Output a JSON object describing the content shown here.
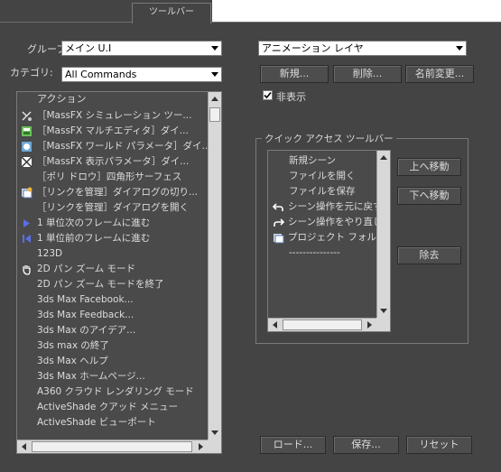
{
  "tabs": {
    "active_label": "ツールバー"
  },
  "left": {
    "group_label": "グループ",
    "group_value": "メイン U.I",
    "category_label": "カテゴリ:",
    "category_value": "All Commands",
    "list_header": "アクション",
    "items": [
      {
        "icon": "massfx-sim-icon",
        "label": "［MassFX シミュレーション ツー..."
      },
      {
        "icon": "massfx-multi-editor-icon",
        "label": "［MassFX マルチエディタ］ダイ..."
      },
      {
        "icon": "massfx-world-params-icon",
        "label": "［MassFX ワールド パラメータ］ダイ..."
      },
      {
        "icon": "massfx-display-params-icon",
        "label": "［MassFX 表示パラメータ］ダイ..."
      },
      {
        "icon": "",
        "label": "［ポリ ドロウ］四角形サーフェス"
      },
      {
        "icon": "manage-links-icon",
        "label": "［リンクを管理］ダイアログの切り..."
      },
      {
        "icon": "",
        "label": "［リンクを管理］ダイアログを開く"
      },
      {
        "icon": "next-frame-icon",
        "label": "1 単位次のフレームに進む"
      },
      {
        "icon": "prev-frame-icon",
        "label": "1 単位前のフレームに進む"
      },
      {
        "icon": "",
        "label": "123D"
      },
      {
        "icon": "pan-zoom-icon",
        "label": "2D パン ズーム モード"
      },
      {
        "icon": "",
        "label": "2D パン ズーム モードを終了"
      },
      {
        "icon": "",
        "label": "3ds Max Facebook..."
      },
      {
        "icon": "",
        "label": "3ds Max Feedback..."
      },
      {
        "icon": "",
        "label": "3ds Max のアイデア..."
      },
      {
        "icon": "",
        "label": "3ds max の終了"
      },
      {
        "icon": "",
        "label": "3ds Max ヘルプ"
      },
      {
        "icon": "",
        "label": "3ds Max ホームページ..."
      },
      {
        "icon": "",
        "label": "A360 クラウド レンダリング モード"
      },
      {
        "icon": "",
        "label": "ActiveShade クアッド メニュー"
      },
      {
        "icon": "",
        "label": "ActiveShade ビューポート"
      }
    ]
  },
  "right": {
    "toolbar_combo_value": "アニメーション レイヤ",
    "new_button": "新規...",
    "delete_button": "削除...",
    "rename_button": "名前変更...",
    "hide_label": "非表示",
    "hide_checked": true,
    "quick_access_title": "クイック アクセス ツールバー",
    "quick_items": [
      {
        "icon": "",
        "label": "新規シーン"
      },
      {
        "icon": "",
        "label": "ファイルを開く"
      },
      {
        "icon": "",
        "label": "ファイルを保存"
      },
      {
        "icon": "undo-icon",
        "label": "シーン操作を元に戻す"
      },
      {
        "icon": "redo-icon",
        "label": "シーン操作をやり直し"
      },
      {
        "icon": "project-folder-icon",
        "label": "プロジェクト フォルダ"
      },
      {
        "icon": "",
        "label": "---------------"
      }
    ],
    "move_up_button": "上へ移動",
    "move_down_button": "下へ移動",
    "remove_button": "除去"
  },
  "footer": {
    "load_button": "ロード...",
    "save_button": "保存...",
    "reset_button": "リセット"
  },
  "colors": {
    "panel_bg": "#444444",
    "list_bg": "#4a4a4a",
    "text": "#dcdcdc"
  }
}
